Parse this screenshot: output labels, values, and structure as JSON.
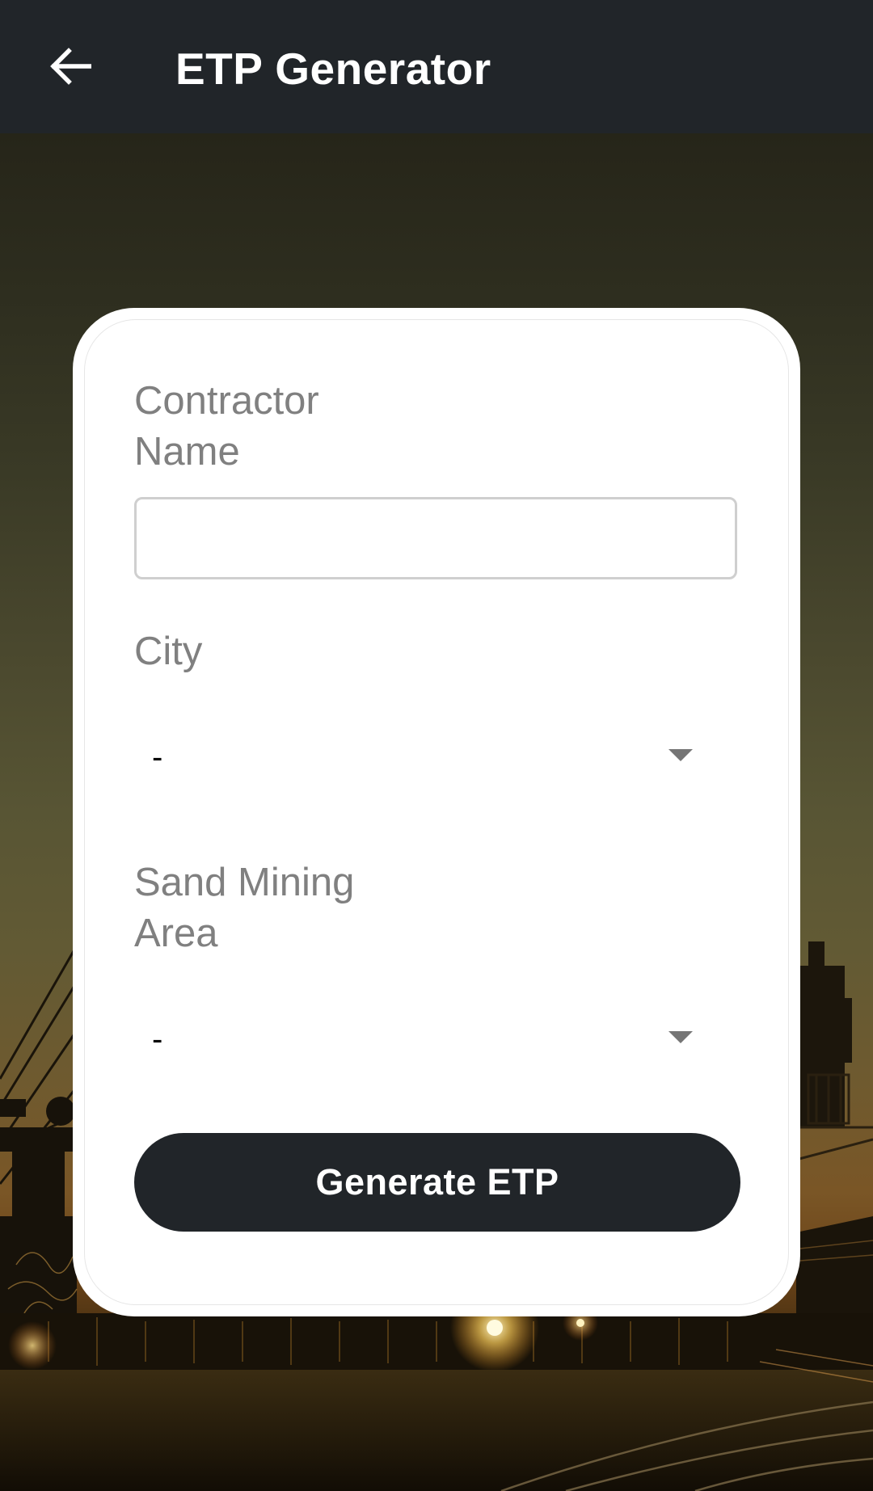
{
  "app_bar": {
    "title": "ETP Generator",
    "back_icon": "arrow-left-icon",
    "background_color": "#212529"
  },
  "form": {
    "contractor_name": {
      "label": "Contractor\nName",
      "value": "",
      "placeholder": ""
    },
    "city": {
      "label": "City",
      "selected": "-"
    },
    "sand_mining_area": {
      "label": "Sand Mining\nArea",
      "selected": "-"
    },
    "submit_label": "Generate ETP"
  },
  "colors": {
    "primary_dark": "#212529",
    "label_gray": "#808080",
    "card_bg": "#ffffff"
  }
}
